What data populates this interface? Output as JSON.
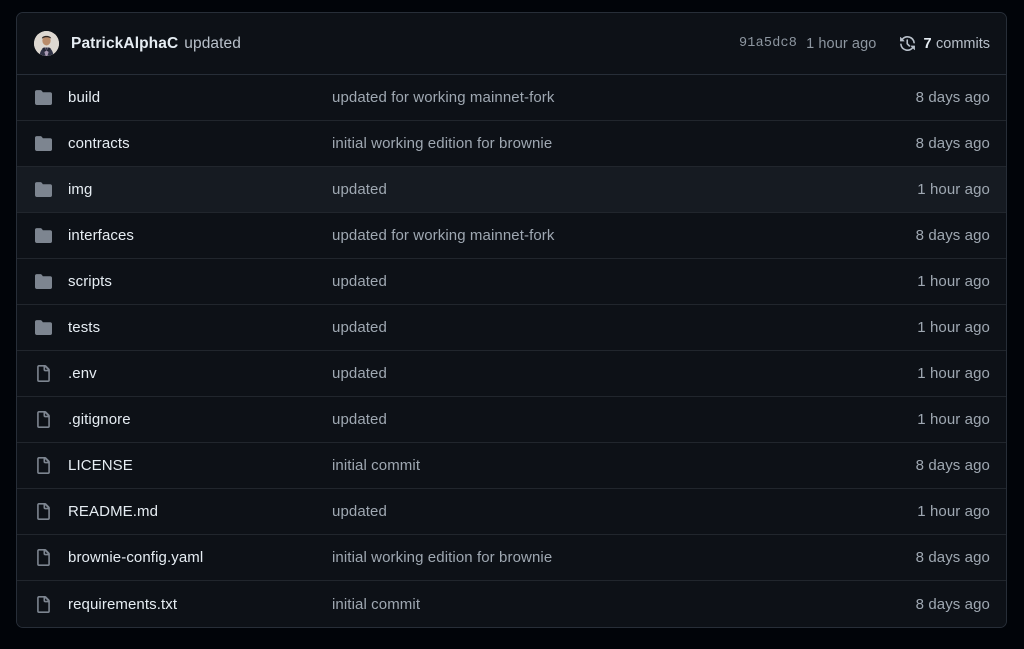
{
  "latest_commit": {
    "avatar_name": "avatar",
    "author": "PatrickAlphaC",
    "message": "updated",
    "sha": "91a5dc8",
    "time": "1 hour ago",
    "commits_icon": "history-icon",
    "commits_count": "7",
    "commits_label": "commits"
  },
  "colors": {
    "page_background": "#010409",
    "panel_background": "#0d1117",
    "row_hover": "#161b22",
    "border": "#272e38",
    "row_divider": "#21262d",
    "text_primary": "#e6edf3",
    "text_muted": "#9fa8b2",
    "folder_icon": "#7d8590",
    "file_icon": "#7d8590"
  },
  "files": [
    {
      "icon": "folder-icon",
      "type": "directory",
      "name": "build",
      "message": "updated for working mainnet-fork",
      "time": "8 days ago",
      "hovered": false
    },
    {
      "icon": "folder-icon",
      "type": "directory",
      "name": "contracts",
      "message": "initial working edition for brownie",
      "time": "8 days ago",
      "hovered": false
    },
    {
      "icon": "folder-icon",
      "type": "directory",
      "name": "img",
      "message": "updated",
      "time": "1 hour ago",
      "hovered": true
    },
    {
      "icon": "folder-icon",
      "type": "directory",
      "name": "interfaces",
      "message": "updated for working mainnet-fork",
      "time": "8 days ago",
      "hovered": false
    },
    {
      "icon": "folder-icon",
      "type": "directory",
      "name": "scripts",
      "message": "updated",
      "time": "1 hour ago",
      "hovered": false
    },
    {
      "icon": "folder-icon",
      "type": "directory",
      "name": "tests",
      "message": "updated",
      "time": "1 hour ago",
      "hovered": false
    },
    {
      "icon": "file-icon",
      "type": "file",
      "name": ".env",
      "message": "updated",
      "time": "1 hour ago",
      "hovered": false
    },
    {
      "icon": "file-icon",
      "type": "file",
      "name": ".gitignore",
      "message": "updated",
      "time": "1 hour ago",
      "hovered": false
    },
    {
      "icon": "file-icon",
      "type": "file",
      "name": "LICENSE",
      "message": "initial commit",
      "time": "8 days ago",
      "hovered": false
    },
    {
      "icon": "file-icon",
      "type": "file",
      "name": "README.md",
      "message": "updated",
      "time": "1 hour ago",
      "hovered": false
    },
    {
      "icon": "file-icon",
      "type": "file",
      "name": "brownie-config.yaml",
      "message": "initial working edition for brownie",
      "time": "8 days ago",
      "hovered": false
    },
    {
      "icon": "file-icon",
      "type": "file",
      "name": "requirements.txt",
      "message": "initial commit",
      "time": "8 days ago",
      "hovered": false
    }
  ]
}
